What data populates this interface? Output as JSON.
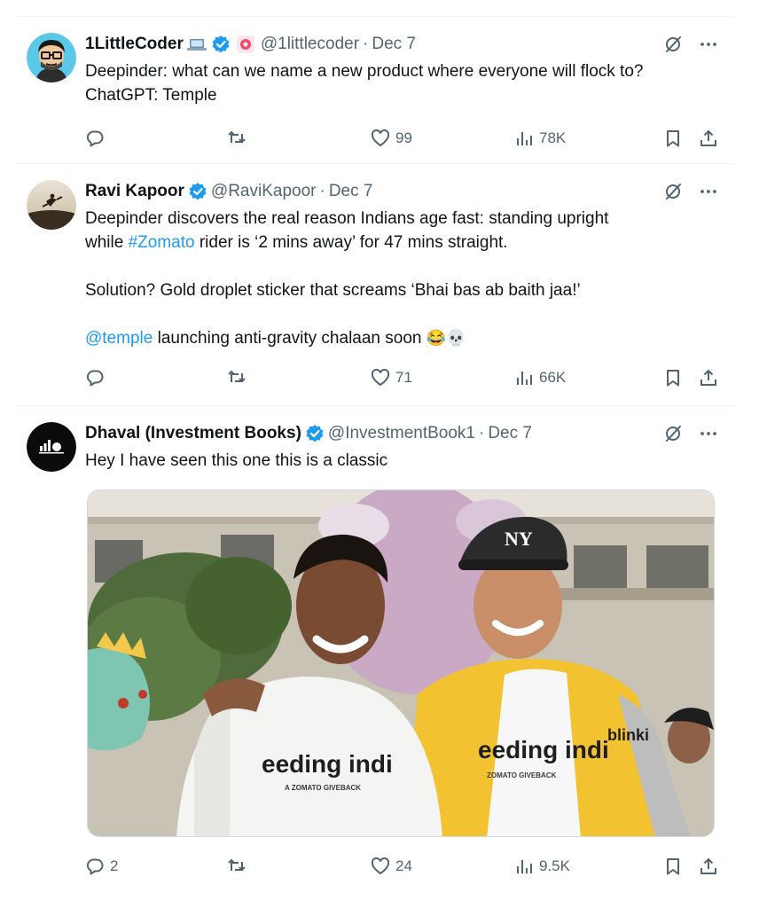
{
  "tweets": [
    {
      "name": "1LittleCoder",
      "handle": "@1littlecoder",
      "date": "Dec 7",
      "text_lines": [
        "Deepinder: what can we name a new product where everyone will flock to?",
        "ChatGPT: Temple"
      ],
      "replies": "",
      "likes": "99",
      "views": "78K"
    },
    {
      "name": "Ravi Kapoor",
      "handle": "@RaviKapoor",
      "date": "Dec 7",
      "line1": "Deepinder discovers the real reason Indians age fast: standing upright",
      "line2_pre": "while ",
      "line2_link": "#Zomato",
      "line2_post": " rider is ‘2 mins away’ for 47 mins straight.",
      "line3": "Solution? Gold droplet sticker that screams ‘Bhai bas ab baith jaa!’",
      "line4_link": "@temple",
      "line4_post": " launching anti-gravity chalaan soon ",
      "emojis": "😂💀",
      "replies": "",
      "likes": "71",
      "views": "66K"
    },
    {
      "name": "Dhaval (Investment Books)",
      "handle": "@InvestmentBook1",
      "date": "Dec 7",
      "text": "Hey I have seen this one this is a classic",
      "replies": "2",
      "likes": "24",
      "views": "9.5K",
      "photo": {
        "left_shirt": "eeding indi",
        "left_shirt_sub": "A ZOMATO GIVEBACK",
        "right_shirt": "eeding indi",
        "right_shirt_sub": "ZOMATO GIVEBACK",
        "cap_logo": "NY",
        "jacket_text": "blinki"
      }
    }
  ],
  "colors": {
    "link": "#1d9bf0",
    "muted": "#536471",
    "verified": "#1d9bf0",
    "divider": "#eff3f4"
  },
  "icons": [
    "verified-icon",
    "laptop-icon",
    "pink-badge-icon",
    "grok-icon",
    "more-icon",
    "reply-icon",
    "retweet-icon",
    "like-icon",
    "views-icon",
    "bookmark-icon",
    "share-icon"
  ]
}
